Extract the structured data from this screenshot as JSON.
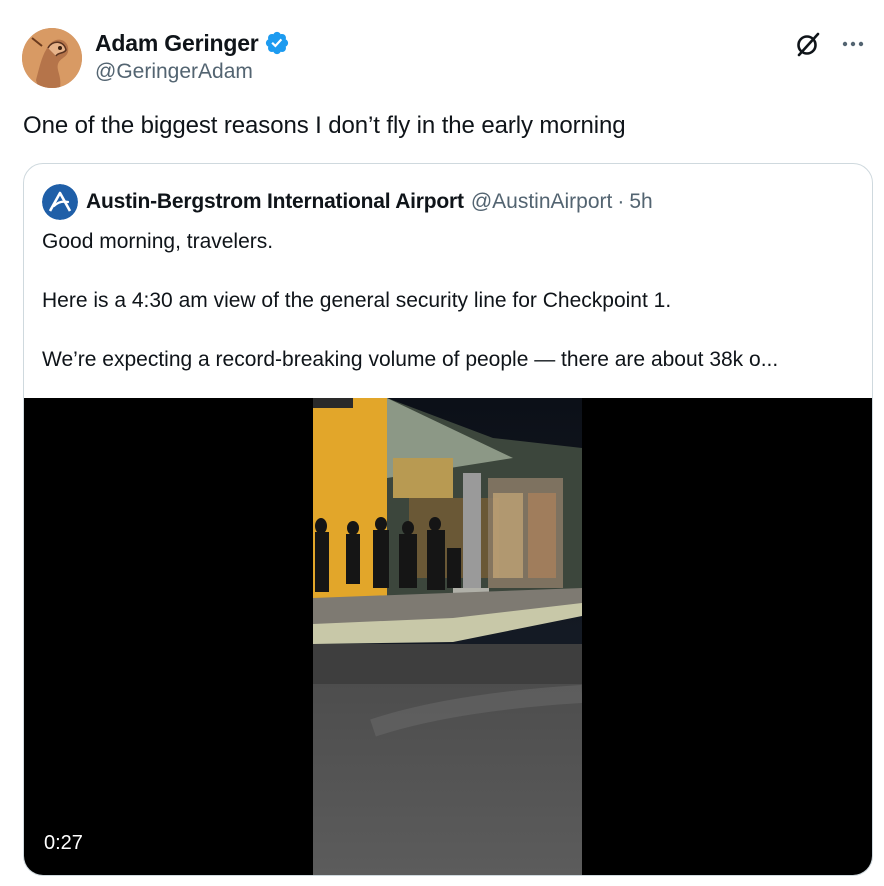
{
  "author": {
    "name": "Adam Geringer",
    "handle": "@GeringerAdam",
    "verified": true
  },
  "tweet_text": "One of the biggest reasons I don’t fly in the early morning",
  "icons": [
    "grok-icon",
    "more-icon",
    "verified-badge-icon",
    "airport-logo-icon"
  ],
  "quoted": {
    "name": "Austin-Bergstrom International Airport",
    "handle": "@AustinAirport",
    "separator": "·",
    "time": "5h",
    "lines": [
      "Good morning, travelers.",
      "Here is a 4:30 am view of the general security line for Checkpoint 1.",
      "We’re expecting a record-breaking volume of people — there are about 38k o..."
    ],
    "video": {
      "duration": "0:27"
    }
  },
  "colors": {
    "text": "#0f1419",
    "secondary": "#536471",
    "border": "#cfd9de",
    "verified_blue": "#1d9bf0",
    "airport_blue": "#1f5fa8"
  }
}
